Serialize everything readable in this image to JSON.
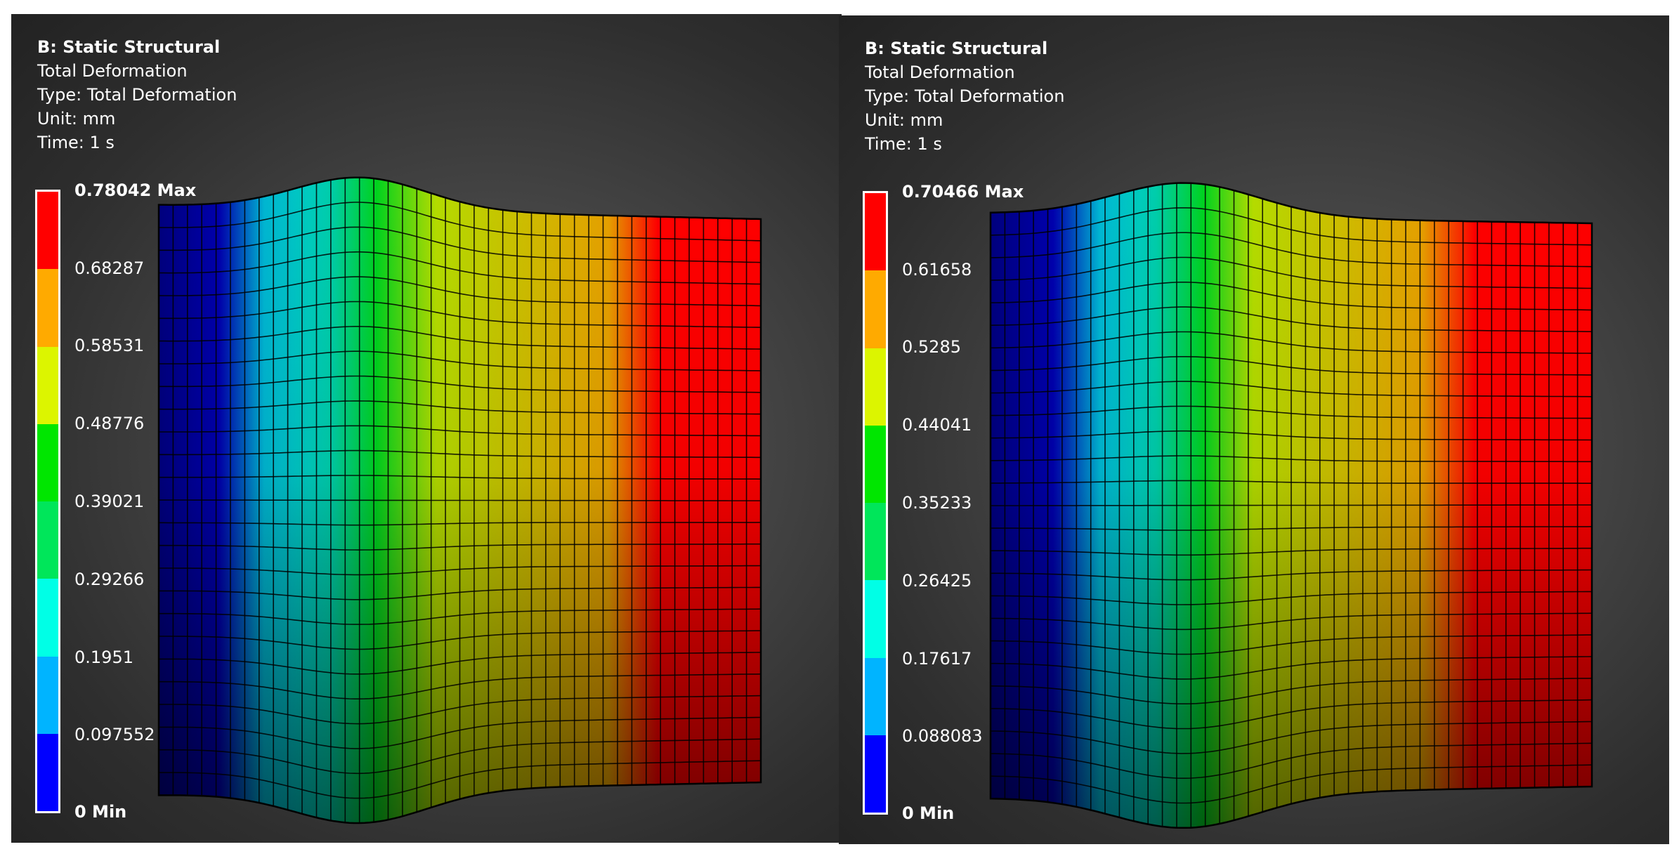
{
  "panels": [
    {
      "title": "B: Static Structural",
      "result": "Total Deformation",
      "type": "Type: Total Deformation",
      "unit": "Unit: mm",
      "time": "Time: 1 s",
      "legend": {
        "labels": [
          "0.78042 Max",
          "0.68287",
          "0.58531",
          "0.48776",
          "0.39021",
          "0.29266",
          "0.1951",
          "0.097552",
          "0 Min"
        ],
        "values": [
          0.78042,
          0.68287,
          0.58531,
          0.48776,
          0.39021,
          0.29266,
          0.1951,
          0.097552,
          0
        ]
      }
    },
    {
      "title": "B: Static Structural",
      "result": "Total Deformation",
      "type": "Type: Total Deformation",
      "unit": "Unit: mm",
      "time": "Time: 1 s",
      "legend": {
        "labels": [
          "0.70466 Max",
          "0.61658",
          "0.5285",
          "0.44041",
          "0.35233",
          "0.26425",
          "0.17617",
          "0.088083",
          "0 Min"
        ],
        "values": [
          0.70466,
          0.61658,
          0.5285,
          0.44041,
          0.35233,
          0.26425,
          0.17617,
          0.088083,
          0
        ]
      }
    }
  ],
  "colors": {
    "legend_top_to_bottom": [
      "#ff0000",
      "#ffaa00",
      "#dcf500",
      "#00e600",
      "#00e65a",
      "#00ffe6",
      "#00b4ff",
      "#0000ff"
    ],
    "background": "#3a3a3a",
    "mesh_line": "#000000",
    "text": "#ffffff"
  }
}
